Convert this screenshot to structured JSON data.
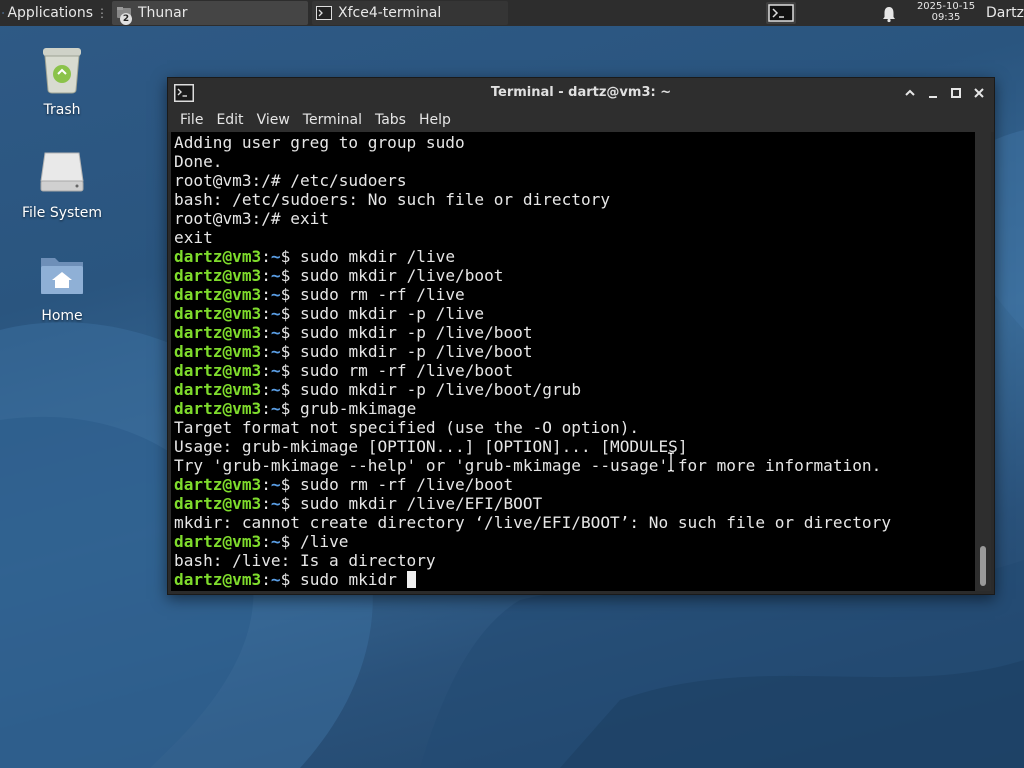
{
  "panel": {
    "applications_label": "Applications",
    "tasks": [
      {
        "label": "Thunar",
        "badge": "2",
        "icon": "folder-icon"
      },
      {
        "label": "Xfce4-terminal",
        "icon": "terminal-icon"
      }
    ],
    "clock_date": "2025-10-15",
    "clock_time": "09:35",
    "user": "Dartz"
  },
  "desktop": {
    "icons": [
      {
        "label": "Trash",
        "icon": "trash-icon"
      },
      {
        "label": "File System",
        "icon": "drive-icon"
      },
      {
        "label": "Home",
        "icon": "home-folder-icon"
      }
    ]
  },
  "window": {
    "title": "Terminal - dartz@vm3: ~",
    "menu": [
      "File",
      "Edit",
      "View",
      "Terminal",
      "Tabs",
      "Help"
    ]
  },
  "colors": {
    "prompt_user": "#7fdc2c",
    "prompt_path": "#5b9fe6",
    "terminal_bg": "#000000",
    "terminal_fg": "#e6e6e6"
  },
  "terminal": {
    "lines": [
      {
        "text": "Adding user greg to group sudo"
      },
      {
        "text": "Done."
      },
      {
        "text": "root@vm3:/# /etc/sudoers"
      },
      {
        "text": "bash: /etc/sudoers: No such file or directory"
      },
      {
        "text": "root@vm3:/# exit"
      },
      {
        "text": "exit"
      },
      {
        "prompt": true,
        "user": "dartz@vm3",
        "path": "~",
        "cmd": " sudo mkdir /live"
      },
      {
        "prompt": true,
        "user": "dartz@vm3",
        "path": "~",
        "cmd": " sudo mkdir /live/boot"
      },
      {
        "prompt": true,
        "user": "dartz@vm3",
        "path": "~",
        "cmd": " sudo rm -rf /live"
      },
      {
        "prompt": true,
        "user": "dartz@vm3",
        "path": "~",
        "cmd": " sudo mkdir -p /live"
      },
      {
        "prompt": true,
        "user": "dartz@vm3",
        "path": "~",
        "cmd": " sudo mkdir -p /live/boot"
      },
      {
        "prompt": true,
        "user": "dartz@vm3",
        "path": "~",
        "cmd": " sudo mkdir -p /live/boot"
      },
      {
        "prompt": true,
        "user": "dartz@vm3",
        "path": "~",
        "cmd": " sudo rm -rf /live/boot"
      },
      {
        "prompt": true,
        "user": "dartz@vm3",
        "path": "~",
        "cmd": " sudo mkdir -p /live/boot/grub"
      },
      {
        "prompt": true,
        "user": "dartz@vm3",
        "path": "~",
        "cmd": " grub-mkimage"
      },
      {
        "text": "Target format not specified (use the -O option)."
      },
      {
        "text": "Usage: grub-mkimage [OPTION...] [OPTION]... [MODULES]"
      },
      {
        "text": "Try 'grub-mkimage --help' or 'grub-mkimage --usage' for more information."
      },
      {
        "prompt": true,
        "user": "dartz@vm3",
        "path": "~",
        "cmd": " sudo rm -rf /live/boot"
      },
      {
        "prompt": true,
        "user": "dartz@vm3",
        "path": "~",
        "cmd": " sudo mkdir /live/EFI/BOOT"
      },
      {
        "text": "mkdir: cannot create directory ‘/live/EFI/BOOT’: No such file or directory"
      },
      {
        "prompt": true,
        "user": "dartz@vm3",
        "path": "~",
        "cmd": " /live"
      },
      {
        "text": "bash: /live: Is a directory"
      },
      {
        "prompt": true,
        "user": "dartz@vm3",
        "path": "~",
        "cmd": " sudo mkidr ",
        "cursor": true
      }
    ]
  }
}
